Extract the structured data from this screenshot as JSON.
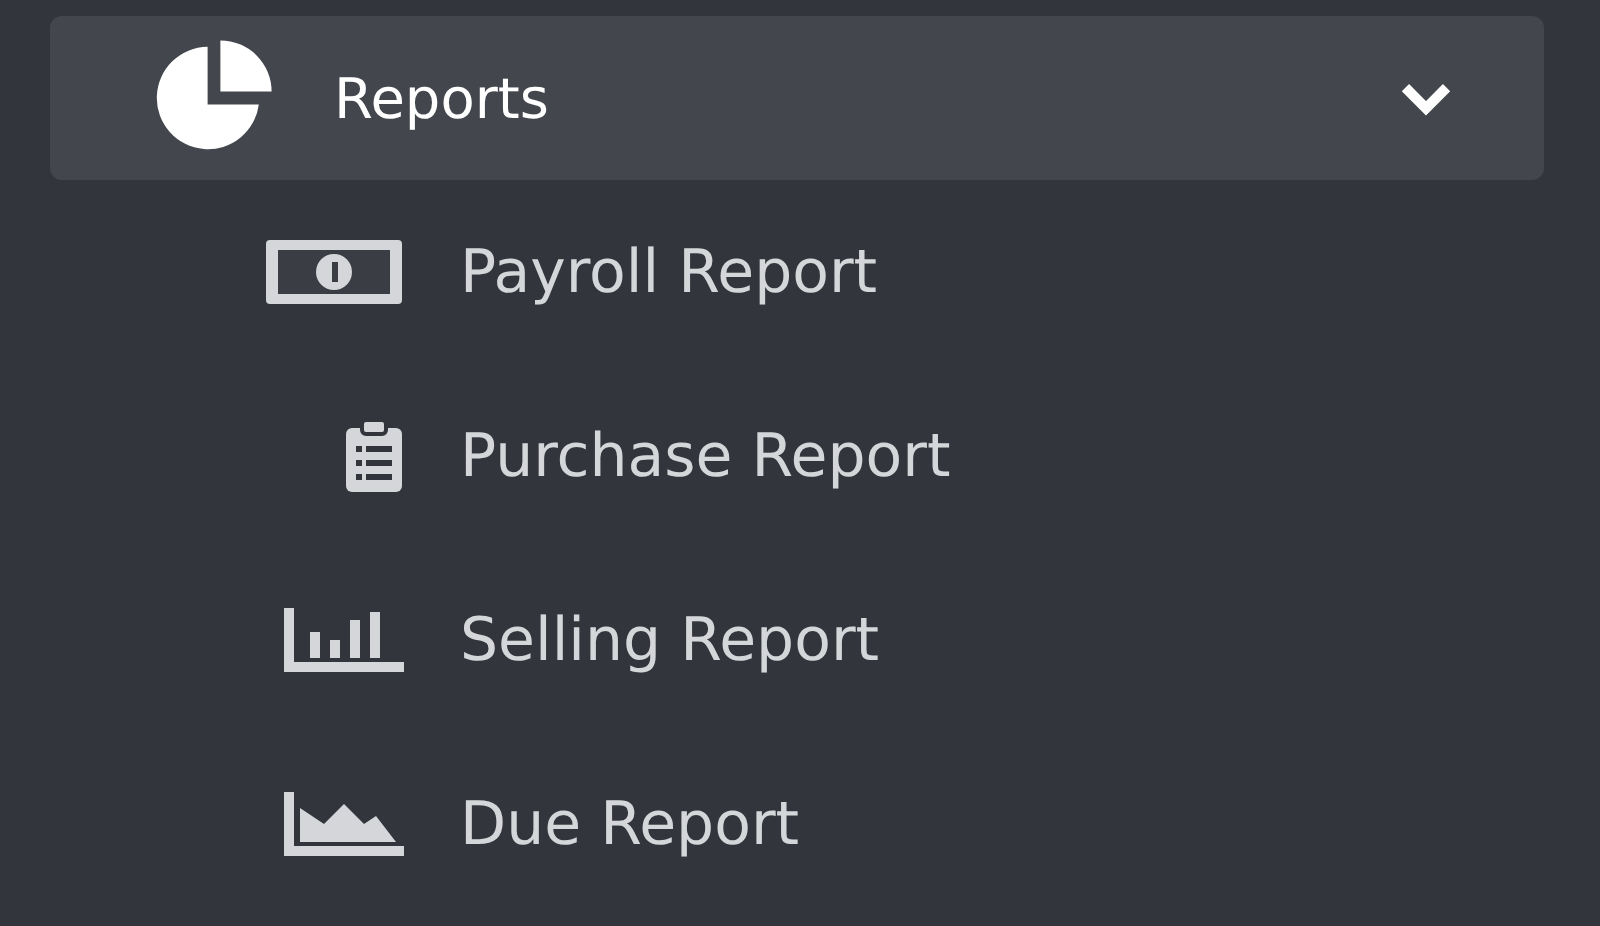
{
  "menu": {
    "label": "Reports",
    "expanded": true,
    "items": [
      {
        "kind": "money",
        "label": "Payroll Report"
      },
      {
        "kind": "clipboard",
        "label": "Purchase Report"
      },
      {
        "kind": "bars",
        "label": "Selling Report"
      },
      {
        "kind": "area",
        "label": "Due Report"
      }
    ]
  }
}
